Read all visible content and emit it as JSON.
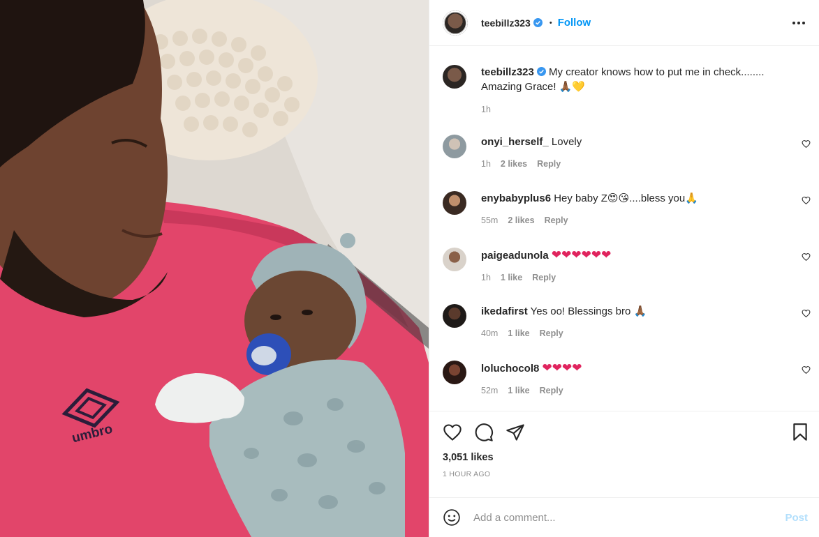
{
  "post": {
    "author": "teebillz323",
    "follow_label": "Follow",
    "dot": "•",
    "caption": {
      "username": "teebillz323",
      "text": "My creator knows how to put me in check........",
      "text2": "Amazing Grace! 🙏🏾💛",
      "time": "1h"
    },
    "comments": [
      {
        "username": "onyi_herself_",
        "text": "Lovely",
        "time": "1h",
        "likes": "2 likes",
        "reply": "Reply"
      },
      {
        "username": "enybabyplus6",
        "text": "Hey baby Z😍😘....bless you🙏",
        "time": "55m",
        "likes": "2 likes",
        "reply": "Reply"
      },
      {
        "username": "paigeadunola",
        "text": "❤❤❤❤❤❤",
        "time": "1h",
        "likes": "1 like",
        "reply": "Reply"
      },
      {
        "username": "ikedafirst",
        "text": "Yes oo! Blessings bro 🙏🏾",
        "time": "40m",
        "likes": "1 like",
        "reply": "Reply"
      },
      {
        "username": "loluchocol8",
        "text": "❤❤❤❤",
        "time": "52m",
        "likes": "1 like",
        "reply": "Reply"
      }
    ],
    "likes_count": "3,051 likes",
    "posted_ago": "1 HOUR AGO",
    "add_comment_placeholder": "Add a comment...",
    "post_label": "Post",
    "photo_brand_text": "umbro"
  },
  "colors": {
    "accent": "#0095f6",
    "post_disabled": "#b2dffc",
    "muted": "#8e8e8e",
    "shirt": "#e2456a",
    "heart_red": "#e0245e"
  },
  "icons": {
    "like": "heart-icon",
    "comment": "comment-bubble-icon",
    "share": "paper-plane-icon",
    "save": "bookmark-icon",
    "emoji": "smiley-icon",
    "more": "more-options-icon",
    "verified": "verified-badge-icon"
  }
}
